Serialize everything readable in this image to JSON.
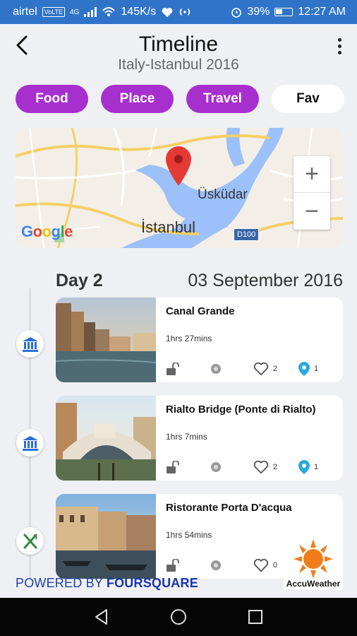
{
  "status_bar": {
    "carrier": "airtel",
    "volte": "VoLTE",
    "network": "4G",
    "speed": "145K/s",
    "battery": "39%",
    "time": "12:27 AM"
  },
  "header": {
    "title": "Timeline",
    "subtitle": "Italy-Istanbul 2016"
  },
  "filters": [
    {
      "label": "Food",
      "style": "purple"
    },
    {
      "label": "Place",
      "style": "purple"
    },
    {
      "label": "Travel",
      "style": "purple"
    },
    {
      "label": "Fav",
      "style": "white"
    }
  ],
  "map": {
    "labels": {
      "city": "İstanbul",
      "district": "Üsküdar",
      "road": "D100"
    },
    "zoom_in": "+",
    "zoom_out": "−",
    "attribution": "Google"
  },
  "day": {
    "label": "Day 2",
    "date": "03 September 2016"
  },
  "places": [
    {
      "name": "Canal Grande",
      "duration": "1hrs 27mins",
      "likes": "2",
      "checkins": "1",
      "category": "landmark-icon"
    },
    {
      "name": "Rialto Bridge (Ponte di Rialto)",
      "duration": "1hrs 7mins",
      "likes": "2",
      "checkins": "1",
      "category": "landmark-icon"
    },
    {
      "name": "Ristorante Porta D'acqua",
      "duration": "1hrs 54mins",
      "likes": "0",
      "checkins": "",
      "category": "restaurant-icon"
    }
  ],
  "footer": {
    "powered_prefix": "POWERED BY",
    "powered_brand": "FOURSQUARE",
    "weather_brand": "AccuWeather"
  },
  "colors": {
    "accent_purple": "#a72fce",
    "status_bar": "#2f74c9",
    "pin_red": "#e53935",
    "checkin_blue": "#2aa8e0",
    "timeline_icon_blue": "#2a6fd6"
  }
}
